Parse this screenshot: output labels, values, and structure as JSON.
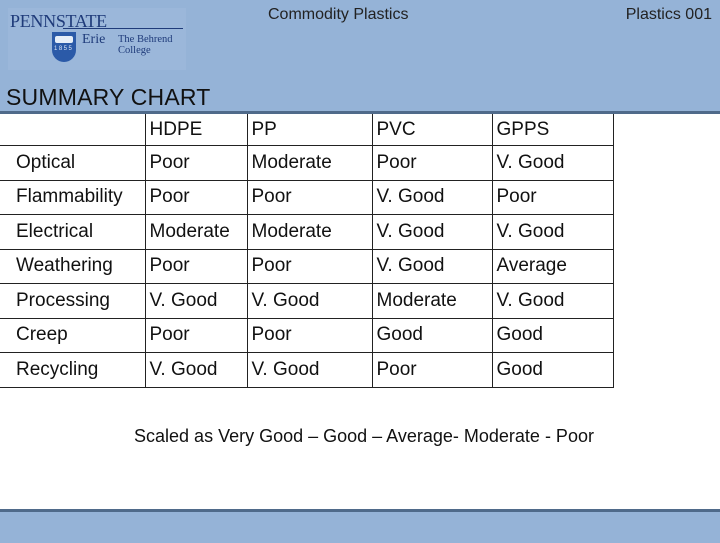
{
  "header": {
    "title": "Commodity Plastics",
    "course_code": "Plastics 001",
    "logo": {
      "line1_prefix": "PENN",
      "line1_suffix": "STATE",
      "campus": "Erie",
      "college_line1": "The Behrend",
      "college_line2": "College",
      "shield_icon": "university-shield-icon"
    }
  },
  "slide": {
    "title": "SUMMARY CHART"
  },
  "table": {
    "columns": [
      "",
      "HDPE",
      "PP",
      "PVC",
      "GPPS"
    ],
    "rows": [
      {
        "property": "Optical",
        "values": [
          "Poor",
          "Moderate",
          "Poor",
          "V. Good"
        ]
      },
      {
        "property": "Flammability",
        "values": [
          "Poor",
          "Poor",
          "V. Good",
          "Poor"
        ]
      },
      {
        "property": "Electrical",
        "values": [
          "Moderate",
          "Moderate",
          "V. Good",
          "V. Good"
        ]
      },
      {
        "property": "Weathering",
        "values": [
          "Poor",
          "Poor",
          "V. Good",
          "Average"
        ]
      },
      {
        "property": "Processing",
        "values": [
          "V. Good",
          "V. Good",
          "Moderate",
          "V. Good"
        ]
      },
      {
        "property": "Creep",
        "values": [
          "Poor",
          "Poor",
          "Good",
          "Good"
        ]
      },
      {
        "property": "Recycling",
        "values": [
          "V. Good",
          "V. Good",
          "Poor",
          "Good"
        ]
      }
    ]
  },
  "scale_note": "Scaled as Very Good – Good – Average- Moderate - Poor",
  "colors": {
    "band": "#95b3d7",
    "band_rule": "#4f6a8a",
    "logo_blue": "#1f3b7a"
  }
}
